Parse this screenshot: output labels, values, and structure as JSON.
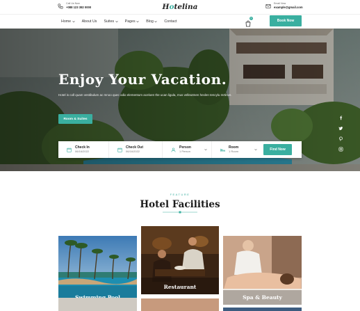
{
  "topbar": {
    "call": {
      "label": "Call Us Now",
      "value": "+088 123 382 0000",
      "icon": "phone-icon"
    },
    "email": {
      "label": "Email Now",
      "value": "example@gmail.com",
      "icon": "mail-icon"
    },
    "logo": {
      "first": "H",
      "accent": "o",
      "rest": "telina"
    }
  },
  "nav": {
    "items": [
      {
        "label": "Home",
        "has_dropdown": true
      },
      {
        "label": "About Us",
        "has_dropdown": false
      },
      {
        "label": "Suites",
        "has_dropdown": true
      },
      {
        "label": "Pages",
        "has_dropdown": true
      },
      {
        "label": "Blog",
        "has_dropdown": true
      },
      {
        "label": "Contact",
        "has_dropdown": false
      }
    ],
    "cart_count": "0",
    "book_label": "Book Now"
  },
  "hero": {
    "title": "Enjoy Your Vacation.",
    "description": "Hotel is coll quam vestibulum ac mnoo quec odio elementum aceloen the ucan ligula, mus velleutmen hexlen tencylu mrtinve.",
    "button_label": "Room & Suites",
    "socials": [
      "facebook-icon",
      "twitter-icon",
      "pinterest-icon",
      "instagram-icon"
    ]
  },
  "booking": {
    "check_in": {
      "label": "Check In",
      "value": "06/16/2022"
    },
    "check_out": {
      "label": "Check Out",
      "value": "06/16/2022"
    },
    "person": {
      "label": "Person",
      "value": "1 Person"
    },
    "room": {
      "label": "Room",
      "value": "1 Room"
    },
    "button_label": "Find Now"
  },
  "facilities": {
    "eyebrow": "FEATURE",
    "title": "Hotel Facilities",
    "cards": [
      {
        "label": "Swimming Pool"
      },
      {
        "label": "Restaurant"
      },
      {
        "label": "Spa & Beauty"
      }
    ]
  },
  "colors": {
    "accent": "#3aafa0",
    "text": "#222222",
    "hero_overlay": "#1d2b22"
  }
}
